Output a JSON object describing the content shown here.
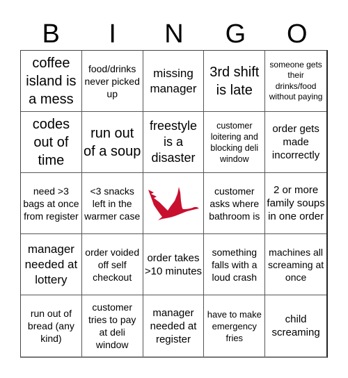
{
  "header": {
    "letters": [
      "B",
      "I",
      "N",
      "G",
      "O"
    ]
  },
  "colors": {
    "logo": "#c8102e"
  },
  "board": {
    "cells": [
      "coffee island is a mess",
      "food/drinks never picked up",
      "missing manager",
      "3rd shift is late",
      "someone gets their drinks/food without paying",
      "codes out of time",
      "run out of a soup",
      "freestyle is a disaster",
      "customer loitering and blocking deli window",
      "order gets made incorrectly",
      "need >3 bags at once from register",
      "<3 snacks left in the warmer case",
      "",
      "customer asks where bathroom is",
      "2 or more family soups in one order",
      "manager needed at lottery",
      "order voided off self checkout",
      "order takes >10 minutes",
      "something falls with a loud crash",
      "machines all screaming at once",
      "run out of bread (any kind)",
      "customer tries to pay at deli window",
      "manager needed at register",
      "have to make emergency fries",
      "child screaming"
    ],
    "free_space_icon": "goose-logo-icon"
  }
}
